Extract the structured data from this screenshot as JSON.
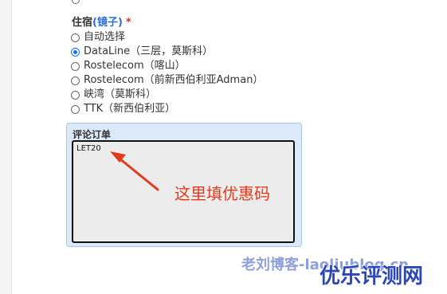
{
  "accommodation": {
    "label": "住宿",
    "label_link": "(镜子)",
    "required_mark": "*",
    "prev_option_cut": "",
    "options": [
      {
        "label": "自动选择",
        "checked": false
      },
      {
        "label": "DataLine（三层，莫斯科）",
        "checked": true
      },
      {
        "label": "Rostelecom（喀山）",
        "checked": false
      },
      {
        "label": "Rostelecom（前新西伯利亚Adman）",
        "checked": false
      },
      {
        "label": "峡湾（莫斯科）",
        "checked": false
      },
      {
        "label": "TTK（新西伯利亚）",
        "checked": false
      }
    ]
  },
  "comment": {
    "title": "评论订单",
    "value": "LET20"
  },
  "annotation": {
    "text": "这里填优惠码",
    "color": "#e23a1e"
  },
  "watermarks": {
    "blog": "老刘博客-laoliublog.cn",
    "main": "优乐评测网"
  }
}
